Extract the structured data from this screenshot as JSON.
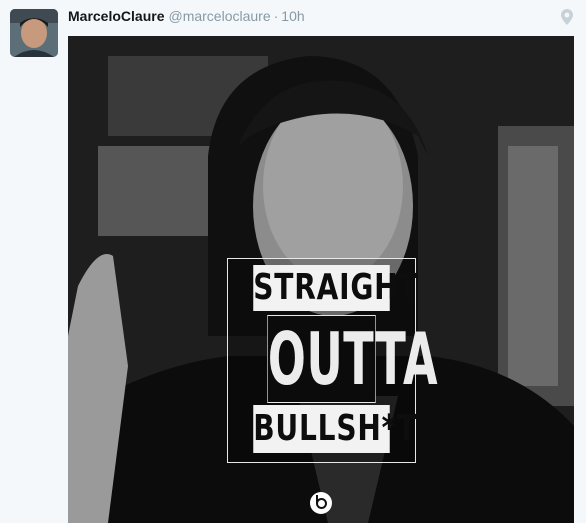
{
  "tweet": {
    "display_name": "MarceloClaure",
    "handle": "@marceloclaure",
    "separator": "·",
    "time": "10h"
  },
  "poster": {
    "line1": "STRAIGHT",
    "line2": "OUTTA",
    "line3": "BULLSH*T"
  },
  "icons": {
    "location": "location-pin-icon",
    "watermark": "beats-logo-icon"
  },
  "colors": {
    "background": "#f5f8fa",
    "name": "#14171a",
    "meta": "#8899a6"
  }
}
